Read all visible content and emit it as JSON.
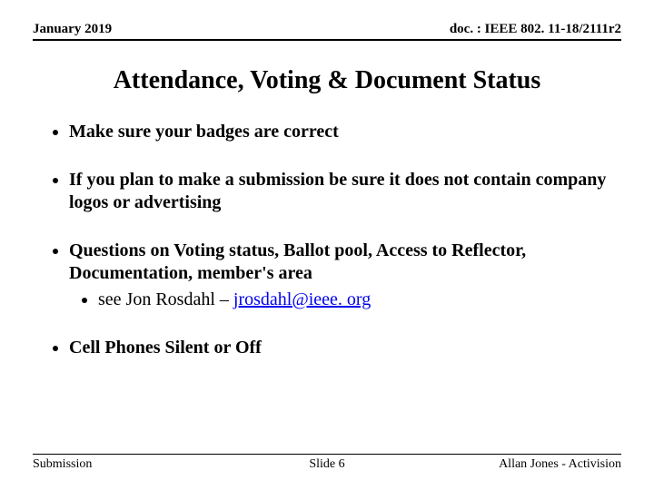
{
  "header": {
    "date": "January 2019",
    "docnum": "doc. : IEEE 802. 11-18/2111r2"
  },
  "title": "Attendance, Voting & Document Status",
  "bullets": [
    {
      "text": "Make sure your badges are correct"
    },
    {
      "text": "If you plan to make a submission be sure it does not contain company logos or advertising"
    },
    {
      "text": "Questions on Voting status, Ballot pool, Access to Reflector, Documentation,  member's area",
      "sub_prefix": "see Jon Rosdahl –  ",
      "sub_email": "jrosdahl@ieee. org"
    },
    {
      "text": "Cell Phones Silent or Off"
    }
  ],
  "footer": {
    "left": "Submission",
    "center": "Slide 6",
    "right": "Allan Jones - Activision"
  }
}
